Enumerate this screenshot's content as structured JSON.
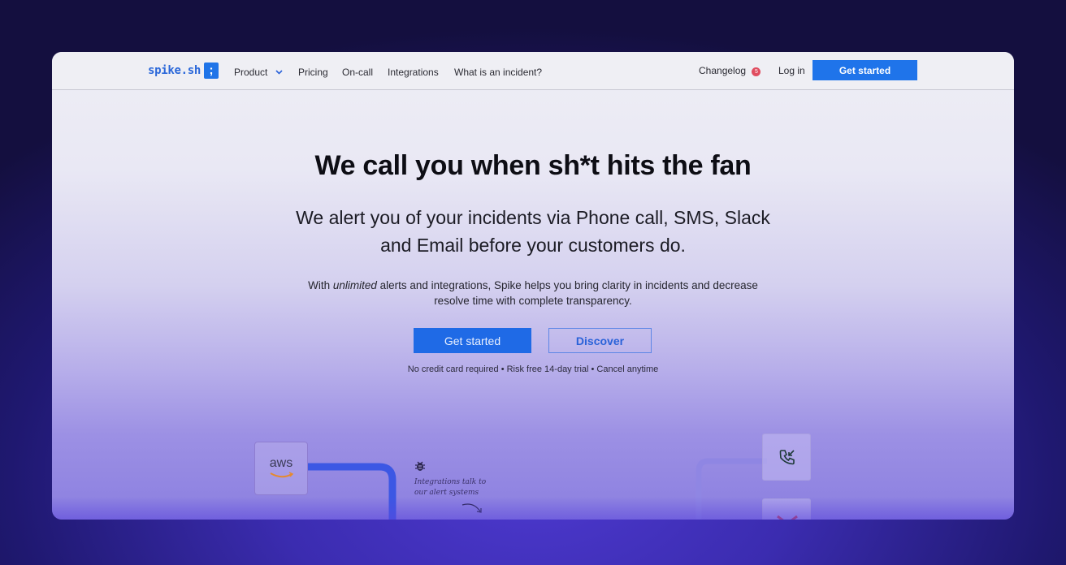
{
  "nav": {
    "logo_text": "spike.sh",
    "logo_mark": ";",
    "links": [
      "Product",
      "Pricing",
      "On-call",
      "Integrations",
      "What is an incident?"
    ],
    "changelog_label": "Changelog",
    "changelog_count": "5",
    "login_label": "Log in",
    "cta_label": "Get started"
  },
  "hero": {
    "title": "We call you when sh*t hits the fan",
    "subtitle_line1": "We alert you of your incidents via Phone call, SMS, Slack",
    "subtitle_line2": "and Email before your customers do.",
    "body_before": "With ",
    "body_emphasis": "unlimited",
    "body_after_line1": " alerts and integrations, Spike helps you bring clarity in incidents and decrease",
    "body_line2": "resolve time with complete transparency.",
    "primary_button": "Get started",
    "secondary_button": "Discover",
    "fine_print": "No credit card required • Risk free 14-day trial • Cancel anytime"
  },
  "illustration": {
    "aws_label": "aws",
    "note_line1": "Integrations talk to",
    "note_line2": "our alert systems",
    "icons": [
      "bug-icon",
      "phone-incoming-icon",
      "gmail-icon",
      "curved-arrow-icon"
    ]
  },
  "colors": {
    "brand_blue": "#1f74ea",
    "badge_red": "#e04c5f",
    "backdrop_purple": "#3b2cb0"
  }
}
